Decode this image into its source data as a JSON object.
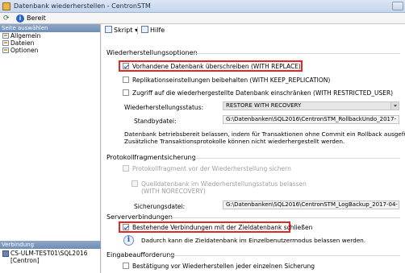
{
  "window": {
    "title": "Datenbank wiederherstellen - CentronSTM"
  },
  "status": {
    "text": "Bereit"
  },
  "left": {
    "pages_header": "Seite auswählen",
    "pages": [
      {
        "label": "Allgemein"
      },
      {
        "label": "Dateien"
      },
      {
        "label": "Optionen"
      }
    ],
    "connection_header": "Verbindung",
    "connection_server": "CS-ULM-TEST01\\SQL2016",
    "connection_db": "[Centron]"
  },
  "toolbar": {
    "script_label": "Skript",
    "help_label": "Hilfe"
  },
  "restore_options": {
    "section_title": "Wiederherstellungsoptionen",
    "overwrite_label": "Vorhandene Datenbank überschreiben (WITH REPLACE)",
    "overwrite_checked": true,
    "replication_label": "Replikationseinstellungen beibehalten (WITH KEEP_REPLICATION)",
    "restrict_label": "Zugriff auf die wiederhergestellte Datenbank einschränken (WITH RESTRICTED_USER)",
    "state_label": "Wiederherstellungsstatus:",
    "state_value": "RESTORE WITH RECOVERY",
    "standby_label": "Standbydatei:",
    "standby_value": "G:\\Datenbanken\\SQL2016\\CentronSTM_RollbackUndo_2017-",
    "desc_line1": "Datenbank betriebsbereit belassen, indem für Transaktionen ohne Commit ein Rollback ausgeführt wird.",
    "desc_line2": "Zusätzliche Transaktionsprotokolle können nicht wiederhergestellt werden."
  },
  "tail_log": {
    "section_title": "Protokollfragmentsicherung",
    "backup_label": "Protokollfragment vor der Wiederherstellung sichern",
    "leave_label_1": "Quelldatenbank im Wiederherstellungsstatus belassen",
    "leave_label_2": "(WITH NORECOVERY)",
    "file_label": "Sicherungsdatei:",
    "file_value": "G:\\Datenbanken\\SQL2016\\CentronSTM_LogBackup_2017-04-"
  },
  "server_connections": {
    "section_title": "Serververbindungen",
    "close_label": "Bestehende Verbindungen mit der Zieldatenbank schließen",
    "close_checked": true,
    "info_text": "Dadurch kann die Zieldatenbank im Einzelbenutzermodus belassen werden."
  },
  "prompt": {
    "section_title": "Eingabeaufforderung",
    "confirm_label": "Bestätigung vor Wiederherstellen jeder einzelnen Sicherung"
  }
}
